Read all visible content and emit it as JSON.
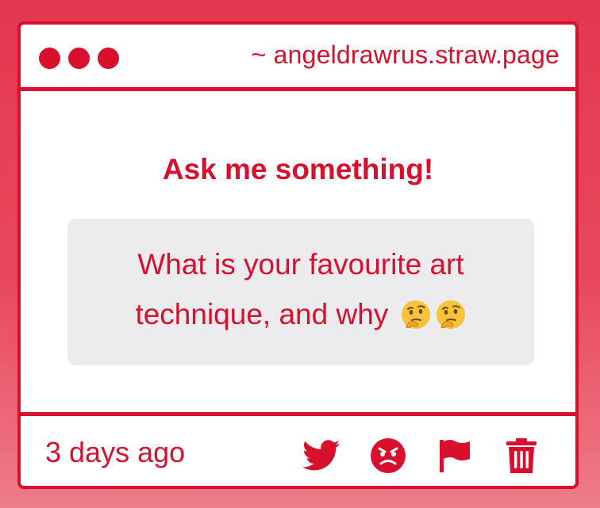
{
  "window": {
    "url": "~ angeldrawrus.straw.page"
  },
  "main": {
    "heading": "Ask me something!",
    "question": "What is your favourite art technique, and why",
    "question_emojis": [
      "thinking-face",
      "thinking-face"
    ]
  },
  "footer": {
    "timestamp": "3 days ago",
    "actions": [
      "twitter-icon",
      "angry-face-icon",
      "flag-icon",
      "trash-icon"
    ]
  },
  "colors": {
    "accent": "#d8102d",
    "question_bg": "#ececee",
    "background_top": "#e4374f",
    "background_bottom": "#ee7c8a"
  }
}
